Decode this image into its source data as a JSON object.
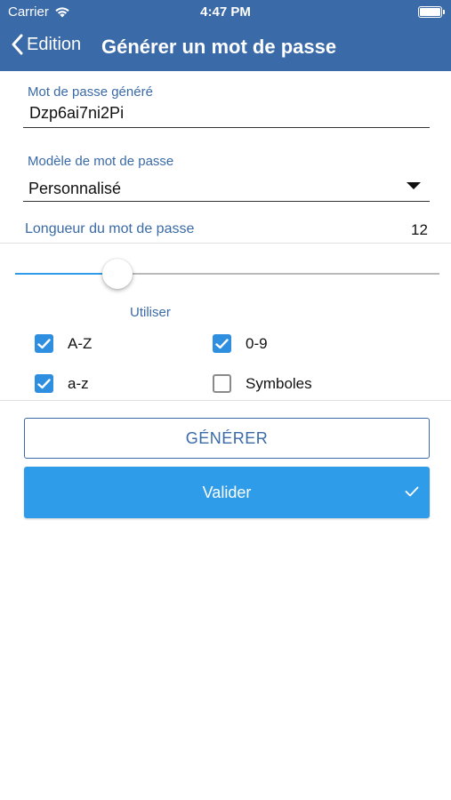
{
  "status_bar": {
    "carrier": "Carrier",
    "time": "4:47 PM",
    "wifi_icon": "wifi-icon",
    "battery_icon": "battery-icon"
  },
  "nav": {
    "back_label": "Edition",
    "title": "Générer un mot de passe",
    "back_icon": "chevron-left-icon"
  },
  "generated": {
    "label": "Mot de passe généré",
    "value": "Dzp6ai7ni2Pi"
  },
  "template": {
    "label": "Modèle de mot de passe",
    "value": "Personnalisé"
  },
  "length": {
    "label": "Longueur du mot de passe",
    "value": "12",
    "slider_fraction": 0.24
  },
  "use": {
    "label": "Utiliser",
    "options": [
      {
        "label": "A-Z",
        "checked": true
      },
      {
        "label": "0-9",
        "checked": true
      },
      {
        "label": "a-z",
        "checked": true
      },
      {
        "label": "Symboles",
        "checked": false
      }
    ]
  },
  "actions": {
    "generate_label": "GÉNÉRER",
    "validate_label": "Valider"
  },
  "colors": {
    "header": "#3a6aa7",
    "accent": "#2e9ce8",
    "label": "#3a6aa7"
  }
}
